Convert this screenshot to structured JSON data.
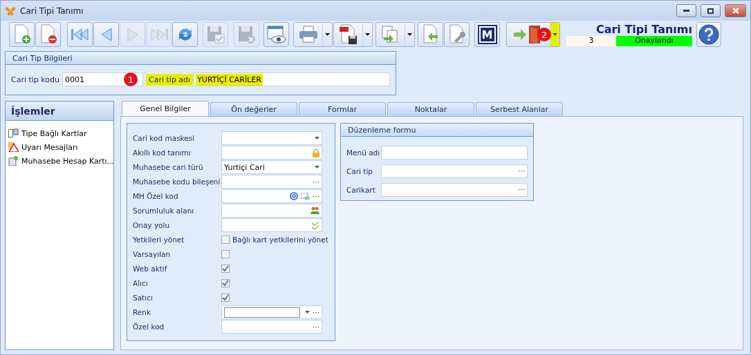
{
  "window": {
    "title": "Cari Tipi Tanımı"
  },
  "toolbar": {
    "buttons": [
      {
        "kind": "new",
        "disabled": false
      },
      {
        "kind": "delete",
        "disabled": false
      },
      {
        "kind": "first",
        "disabled": false
      },
      {
        "kind": "prev",
        "disabled": false
      },
      {
        "kind": "next",
        "disabled": true
      },
      {
        "kind": "last",
        "disabled": true
      },
      {
        "kind": "refresh",
        "disabled": false
      },
      {
        "kind": "save",
        "disabled": true
      },
      {
        "kind": "cancel",
        "disabled": true
      },
      {
        "kind": "preview",
        "disabled": false
      },
      {
        "kind": "print",
        "disabled": false
      },
      {
        "kind": "pdf",
        "disabled": false
      },
      {
        "kind": "export",
        "disabled": false
      },
      {
        "kind": "import",
        "disabled": false
      },
      {
        "kind": "tools",
        "disabled": false
      },
      {
        "kind": "m",
        "disabled": false,
        "label": "M"
      },
      {
        "kind": "exit",
        "disabled": false,
        "marker": "2",
        "highlighted": true
      }
    ],
    "heading": "Cari Tipi Tanımı",
    "count": "3",
    "status": "Onaylandı"
  },
  "info_group": {
    "title": "Cari Tip Bilgileri",
    "code_label": "Cari tip kodu",
    "code_value": "0001",
    "marker": "1",
    "name_label": "Cari tip adı",
    "name_value": "YURTİÇİ CARİLER",
    "highlighted": true
  },
  "sidebar": {
    "title": "İşlemler",
    "items": [
      {
        "kind": "cards",
        "label": "Tipe Bağlı Kartlar"
      },
      {
        "kind": "warning",
        "label": "Uyarı Mesajları"
      },
      {
        "kind": "ledger",
        "label": "Muhasebe Hesap Kartı..."
      }
    ]
  },
  "tabs": [
    {
      "label": "Genel Bilgiler",
      "selected": true
    },
    {
      "label": "Ön değerler",
      "selected": false
    },
    {
      "label": "Formlar",
      "selected": false
    },
    {
      "label": "Noktalar",
      "selected": false
    },
    {
      "label": "Serbest Alanlar",
      "selected": false
    }
  ],
  "general_form": {
    "rows": [
      {
        "kind": "combo",
        "label": "Cari kod maskesi"
      },
      {
        "kind": "lock",
        "label": "Akıllı kod tanımı"
      },
      {
        "kind": "combo",
        "label": "Muhasebe cari türü",
        "value": "Yurtiçi Cari"
      },
      {
        "kind": "ellipsis",
        "label": "Muhasebe kodu bileşeni"
      },
      {
        "kind": "special",
        "label": "MH Özel kod"
      },
      {
        "kind": "people",
        "label": "Sorumluluk alanı"
      },
      {
        "kind": "approval",
        "label": "Onay yolu"
      },
      {
        "kind": "checkbox",
        "label": "Yetkileri yönet",
        "checked": false,
        "caption": "Bağlı kart yetkilerini yönet"
      },
      {
        "kind": "checkbox",
        "label": "Varsayılan",
        "checked": false
      },
      {
        "kind": "checkbox",
        "label": "Web aktif",
        "checked": true
      },
      {
        "kind": "checkbox",
        "label": "Alıcı",
        "checked": true
      },
      {
        "kind": "checkbox",
        "label": "Satıcı",
        "checked": true
      },
      {
        "kind": "color",
        "label": "Renk"
      },
      {
        "kind": "ellipsis",
        "label": "Özel kod"
      }
    ]
  },
  "edit_form": {
    "title": "Düzenleme formu",
    "rows": [
      {
        "kind": "text",
        "label": "Menü adı"
      },
      {
        "kind": "ellipsis",
        "label": "Cari tip"
      },
      {
        "kind": "ellipsis",
        "label": "Carikart"
      }
    ]
  }
}
